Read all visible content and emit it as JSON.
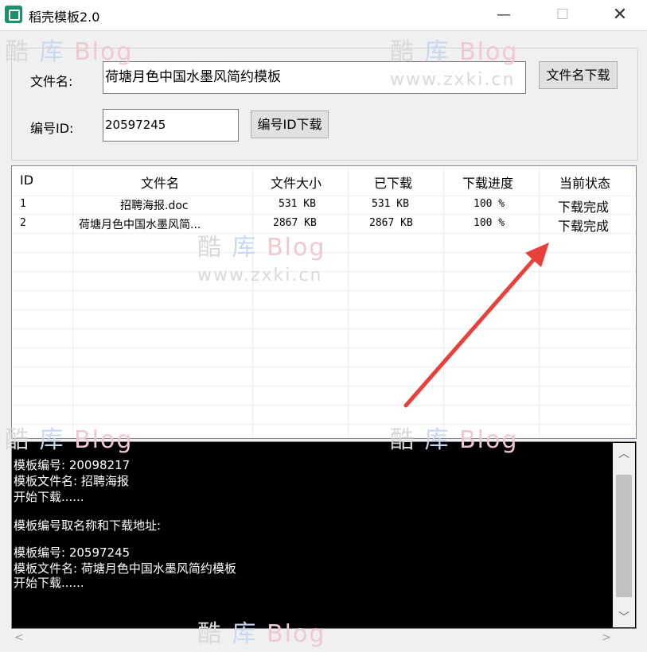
{
  "window": {
    "title": "稻壳模板2.0",
    "minimize_symbol": "—",
    "maximize_symbol": "☐",
    "close_symbol": "✕",
    "app_icon": "app-logo-icon"
  },
  "form": {
    "filename_label": "文件名:",
    "filename_value": "荷塘月色中国水墨风简约模板",
    "filename_button": "文件名下载",
    "id_label": "编号ID:",
    "id_value": "20597245",
    "id_button": "编号ID下载"
  },
  "table": {
    "headers": [
      "ID",
      "文件名",
      "文件大小",
      "已下载",
      "下载进度",
      "当前状态"
    ],
    "rows": [
      [
        "1",
        "招聘海报.doc",
        "531 KB",
        "531 KB",
        "100 %",
        "下载完成"
      ],
      [
        "2",
        "荷塘月色中国水墨风简...",
        "2867 KB",
        "2867 KB",
        "100 %",
        "下载完成"
      ]
    ]
  },
  "console": {
    "lines": [
      "模板编号: 20098217",
      "模板文件名: 招聘海报",
      "开始下载......",
      "",
      "模板编号取名称和下载地址:",
      "",
      "模板编号: 20597245",
      "模板文件名: 荷塘月色中国水墨风简约模板",
      "开始下载......"
    ]
  },
  "watermark": {
    "brand_a": "酷",
    "brand_b": "库",
    "brand_c": "Blog",
    "url": "www.zxki.cn"
  },
  "annotation": {
    "arrow_color": "#e8413c"
  }
}
